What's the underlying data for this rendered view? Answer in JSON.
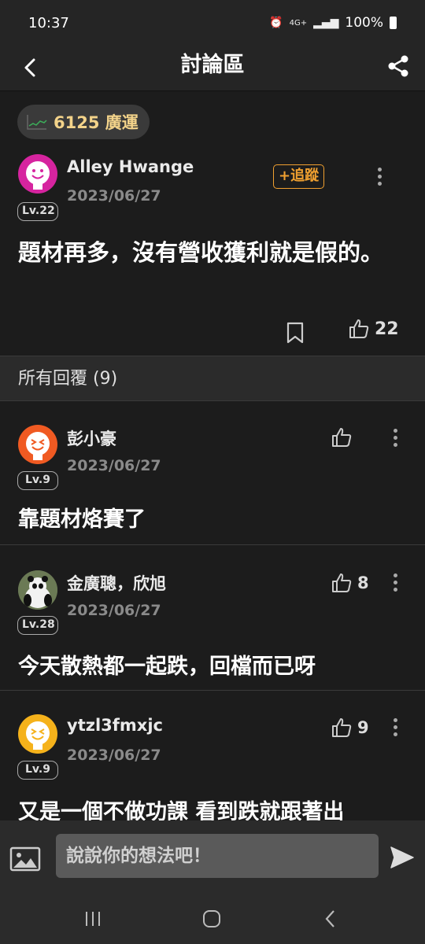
{
  "status_bar": {
    "time": "10:37",
    "network": "4G+",
    "battery": "100%"
  },
  "app_bar": {
    "title": "討論區"
  },
  "post": {
    "stock_chip": "6125 廣運",
    "author": "Alley  Hwange",
    "date": "2023/06/27",
    "level": "Lv.22",
    "follow_label": "+追蹤",
    "body": "題材再多，沒有營收獲利就是假的。",
    "likes": "22"
  },
  "replies_header": "所有回覆 (9)",
  "replies": [
    {
      "author": "彭小豪",
      "date": "2023/06/27",
      "level": "Lv.9",
      "body": "靠題材烙賽了",
      "likes": ""
    },
    {
      "author": "金廣聰，欣旭",
      "date": "2023/06/27",
      "level": "Lv.28",
      "body": "今天散熱都一起跌，回檔而已呀",
      "likes": "8"
    },
    {
      "author": "ytzl3fmxjc",
      "date": "2023/06/27",
      "level": "Lv.9",
      "body": "又是一個不做功課 看到跌就跟著出",
      "likes": "9"
    }
  ],
  "composer": {
    "placeholder": "說說你的想法吧！"
  },
  "colors": {
    "accent": "#f0a030",
    "chip_text": "#f3d38a",
    "background": "#1c1c1c"
  }
}
